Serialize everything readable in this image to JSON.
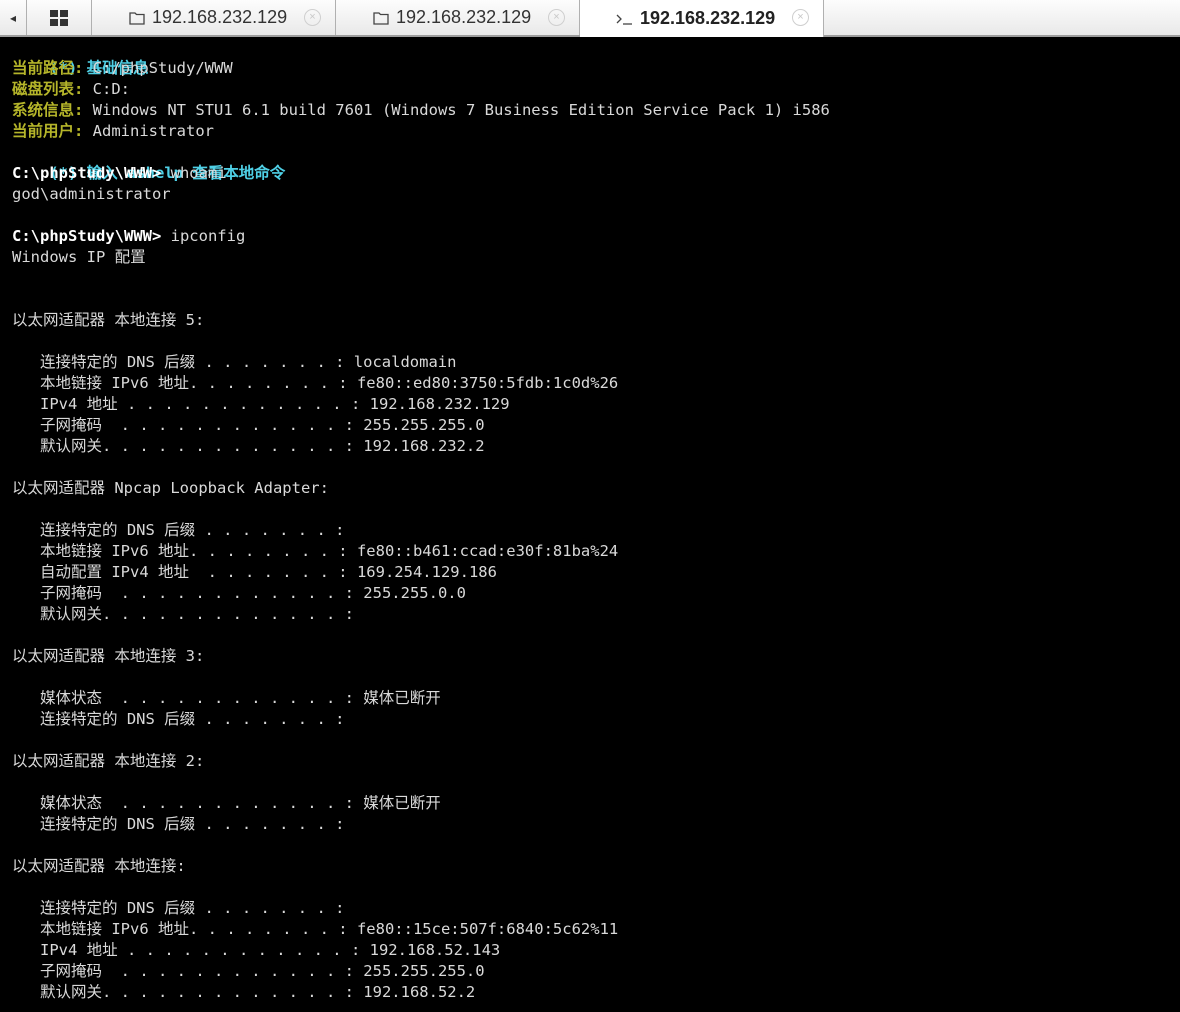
{
  "tabs": [
    {
      "icon": "folder-icon",
      "title": "192.168.232.129",
      "active": false
    },
    {
      "icon": "folder-icon",
      "title": "192.168.232.129",
      "active": false
    },
    {
      "icon": "terminal-icon",
      "title": "192.168.232.129",
      "active": true
    }
  ],
  "tab_close_glyph": "×",
  "scroll_glyph": "◂",
  "terminal": {
    "info_header": "(*) 基础信息",
    "current_path_label": "当前路径:",
    "current_path_value": " C:/phpStudy/WWW",
    "disk_label": "磁盘列表:",
    "disk_value": " C:D:",
    "sysinfo_label": "系统信息:",
    "sysinfo_value": " Windows NT STU1 6.1 build 7601 (Windows 7 Business Edition Service Pack 1) i586",
    "user_label": "当前用户:",
    "user_value": " Administrator",
    "help_hint": "(*) 输入 ashelp 查看本地命令",
    "prompt": "C:\\phpStudy\\WWW>",
    "cmd1": " whoami",
    "out_whoami": "god\\administrator",
    "cmd2": " ipconfig",
    "ip_lines": [
      "Windows IP 配置",
      "",
      "",
      "以太网适配器 本地连接 5:",
      "",
      "   连接特定的 DNS 后缀 . . . . . . . : localdomain",
      "   本地链接 IPv6 地址. . . . . . . . : fe80::ed80:3750:5fdb:1c0d%26",
      "   IPv4 地址 . . . . . . . . . . . . : 192.168.232.129",
      "   子网掩码  . . . . . . . . . . . . : 255.255.255.0",
      "   默认网关. . . . . . . . . . . . . : 192.168.232.2",
      "",
      "以太网适配器 Npcap Loopback Adapter:",
      "",
      "   连接特定的 DNS 后缀 . . . . . . . :",
      "   本地链接 IPv6 地址. . . . . . . . : fe80::b461:ccad:e30f:81ba%24",
      "   自动配置 IPv4 地址  . . . . . . . : 169.254.129.186",
      "   子网掩码  . . . . . . . . . . . . : 255.255.0.0",
      "   默认网关. . . . . . . . . . . . . :",
      "",
      "以太网适配器 本地连接 3:",
      "",
      "   媒体状态  . . . . . . . . . . . . : 媒体已断开",
      "   连接特定的 DNS 后缀 . . . . . . . :",
      "",
      "以太网适配器 本地连接 2:",
      "",
      "   媒体状态  . . . . . . . . . . . . : 媒体已断开",
      "   连接特定的 DNS 后缀 . . . . . . . :",
      "",
      "以太网适配器 本地连接:",
      "",
      "   连接特定的 DNS 后缀 . . . . . . . :",
      "   本地链接 IPv6 地址. . . . . . . . : fe80::15ce:507f:6840:5c62%11",
      "   IPv4 地址 . . . . . . . . . . . . : 192.168.52.143",
      "   子网掩码  . . . . . . . . . . . . : 255.255.255.0",
      "   默认网关. . . . . . . . . . . . . : 192.168.52.2"
    ]
  },
  "colors": {
    "background": "#000000",
    "label": "#b5b52a",
    "highlight": "#4fd0e6",
    "text": "#d9d9d9",
    "prompt": "#ffffff"
  }
}
